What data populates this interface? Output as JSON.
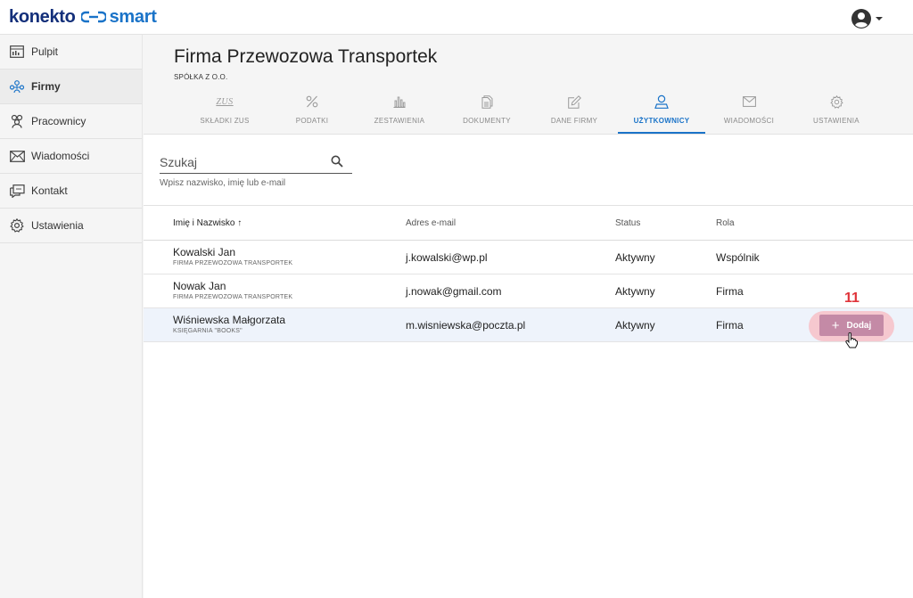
{
  "brand": {
    "part1": "konekto",
    "part2": "smart"
  },
  "sidebar": {
    "items": [
      {
        "label": "Pulpit",
        "icon": "dashboard-icon"
      },
      {
        "label": "Firmy",
        "icon": "companies-icon",
        "active": true
      },
      {
        "label": "Pracownicy",
        "icon": "employees-icon"
      },
      {
        "label": "Wiadomości",
        "icon": "mail-icon"
      },
      {
        "label": "Kontakt",
        "icon": "contact-icon"
      },
      {
        "label": "Ustawienia",
        "icon": "gear-icon"
      }
    ]
  },
  "company": {
    "title": "Firma Przewozowa Transportek",
    "subtitle": "SPÓŁKA Z O.O."
  },
  "tabs": [
    {
      "label": "SKŁADKI ZUS",
      "icon": "zus-icon",
      "icon_text": "ZUS"
    },
    {
      "label": "PODATKI",
      "icon": "percent-icon"
    },
    {
      "label": "ZESTAWIENIA",
      "icon": "bar-chart-icon"
    },
    {
      "label": "DOKUMENTY",
      "icon": "documents-icon"
    },
    {
      "label": "DANE FIRMY",
      "icon": "edit-icon"
    },
    {
      "label": "UŻYTKOWNICY",
      "icon": "user-icon",
      "active": true
    },
    {
      "label": "WIADOMOŚCI",
      "icon": "mail-icon"
    },
    {
      "label": "USTAWIENIA",
      "icon": "gear-icon"
    }
  ],
  "search": {
    "placeholder": "Szukaj",
    "hint": "Wpisz nazwisko, imię lub e-mail"
  },
  "table": {
    "columns": {
      "name": "Imię i Nazwisko",
      "sort_arrow": "↑",
      "email": "Adres e-mail",
      "status": "Status",
      "role": "Rola"
    },
    "rows": [
      {
        "name": "Kowalski Jan",
        "company": "FIRMA PRZEWOZOWA TRANSPORTEK",
        "email": "j.kowalski@wp.pl",
        "status": "Aktywny",
        "role": "Wspólnik"
      },
      {
        "name": "Nowak Jan",
        "company": "FIRMA PRZEWOZOWA TRANSPORTEK",
        "email": "j.nowak@gmail.com",
        "status": "Aktywny",
        "role": "Firma"
      },
      {
        "name": "Wiśniewska Małgorzata",
        "company": "KSIĘGARNIA \"BOOKS\"",
        "email": "m.wisniewska@poczta.pl",
        "status": "Aktywny",
        "role": "Firma",
        "highlighted": true
      }
    ]
  },
  "add_button": {
    "plus": "+",
    "label": "Dodaj"
  },
  "annotation": {
    "step": "11"
  },
  "colors": {
    "accent": "#1a73c8",
    "brand_dark": "#132f7a",
    "add_button": "#c48aa6",
    "step": "#e0353b"
  }
}
